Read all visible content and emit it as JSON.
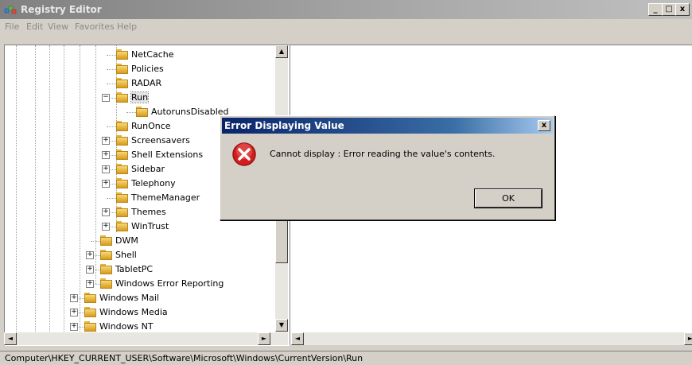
{
  "window": {
    "title": "Registry Editor",
    "buttons": {
      "minimize": "_",
      "maximize": "□",
      "close": "x"
    }
  },
  "menu": [
    "File",
    "Edit",
    "View",
    "Favorites",
    "Help"
  ],
  "tree": {
    "items": [
      {
        "label": "NetCache",
        "level": 4,
        "expander": "none"
      },
      {
        "label": "Policies",
        "level": 4,
        "expander": "none"
      },
      {
        "label": "RADAR",
        "level": 4,
        "expander": "none"
      },
      {
        "label": "Run",
        "level": 4,
        "expander": "minus",
        "selected": true
      },
      {
        "label": "AutorunsDisabled",
        "level": 5,
        "expander": "none"
      },
      {
        "label": "RunOnce",
        "level": 4,
        "expander": "none"
      },
      {
        "label": "Screensavers",
        "level": 4,
        "expander": "plus"
      },
      {
        "label": "Shell Extensions",
        "level": 4,
        "expander": "plus"
      },
      {
        "label": "Sidebar",
        "level": 4,
        "expander": "plus"
      },
      {
        "label": "Telephony",
        "level": 4,
        "expander": "plus"
      },
      {
        "label": "ThemeManager",
        "level": 4,
        "expander": "none"
      },
      {
        "label": "Themes",
        "level": 4,
        "expander": "plus"
      },
      {
        "label": "WinTrust",
        "level": 4,
        "expander": "plus"
      },
      {
        "label": "DWM",
        "level": 3,
        "expander": "none"
      },
      {
        "label": "Shell",
        "level": 3,
        "expander": "plus"
      },
      {
        "label": "TabletPC",
        "level": 3,
        "expander": "plus"
      },
      {
        "label": "Windows Error Reporting",
        "level": 3,
        "expander": "plus"
      },
      {
        "label": "Windows Mail",
        "level": 2,
        "expander": "plus"
      },
      {
        "label": "Windows Media",
        "level": 2,
        "expander": "plus"
      },
      {
        "label": "Windows NT",
        "level": 2,
        "expander": "plus"
      }
    ]
  },
  "status": "Computer\\HKEY_CURRENT_USER\\Software\\Microsoft\\Windows\\CurrentVersion\\Run",
  "dialog": {
    "title": "Error Displaying Value",
    "message": "Cannot display :  Error reading the value's contents.",
    "ok_label": "OK",
    "close_label": "x",
    "icon": "error-icon"
  },
  "scroll": {
    "up": "▲",
    "down": "▼",
    "left": "◄",
    "right": "►"
  },
  "colors": {
    "dialog_title": "#0a246a",
    "error_red": "#d21e1e",
    "folder": "#e8b43a"
  }
}
